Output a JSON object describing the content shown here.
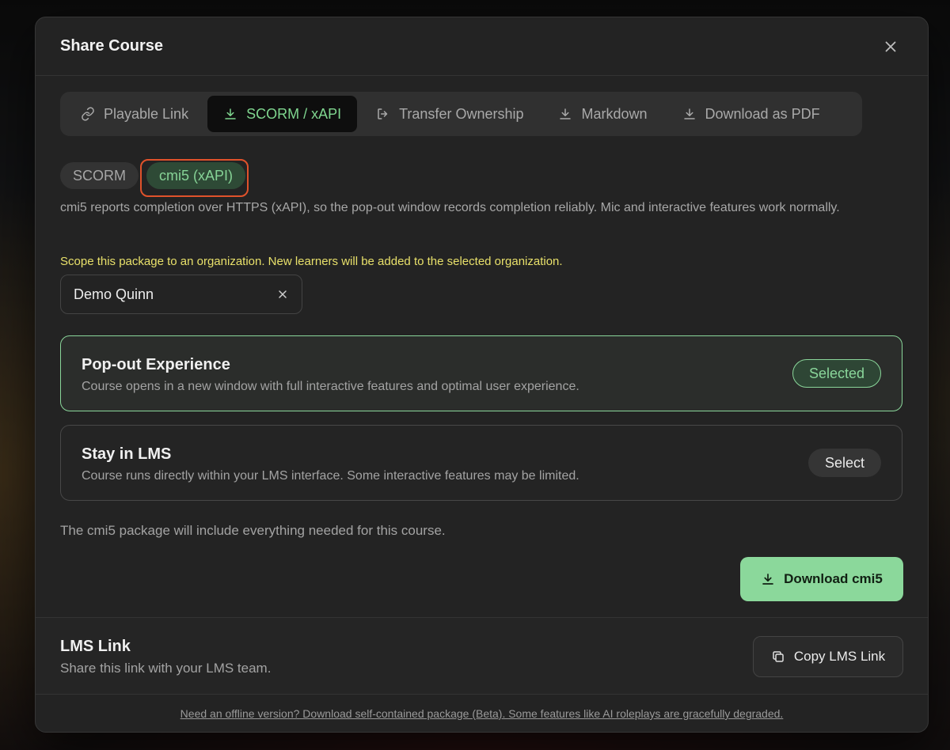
{
  "dialog": {
    "title": "Share Course"
  },
  "tabs": [
    {
      "label": "Playable Link",
      "icon": "link-icon",
      "active": false
    },
    {
      "label": "SCORM / xAPI",
      "icon": "download-icon",
      "active": true
    },
    {
      "label": "Transfer Ownership",
      "icon": "transfer-icon",
      "active": false
    },
    {
      "label": "Markdown",
      "icon": "download-icon",
      "active": false
    },
    {
      "label": "Download as PDF",
      "icon": "download-icon",
      "active": false
    }
  ],
  "format_tabs": [
    {
      "label": "SCORM",
      "active": false
    },
    {
      "label": "cmi5 (xAPI)",
      "active": true
    }
  ],
  "description": "cmi5 reports completion over HTTPS (xAPI), so the pop-out window records completion reliably. Mic and interactive features work normally.",
  "scope_note": "Scope this package to an organization. New learners will be added to the selected organization.",
  "organization": {
    "value": "Demo Quinn"
  },
  "options": [
    {
      "title": "Pop-out Experience",
      "subtitle": "Course opens in a new window with full interactive features and optimal user experience.",
      "button": "Selected"
    },
    {
      "title": "Stay in LMS",
      "subtitle": "Course runs directly within your LMS interface. Some interactive features may be limited.",
      "button": "Select"
    }
  ],
  "package_note": "The cmi5 package will include everything needed for this course.",
  "download_button": "Download cmi5",
  "lms": {
    "title": "LMS Link",
    "subtitle": "Share this link with your LMS team.",
    "copy_button": "Copy LMS Link"
  },
  "footer_link": "Need an offline version? Download self-contained package (Beta). Some features like AI roleplays are gracefully degraded.",
  "colors": {
    "accent": "#8bd89b",
    "warning_text": "#e8e06a",
    "highlight": "#e0522b",
    "panel": "#232323"
  }
}
